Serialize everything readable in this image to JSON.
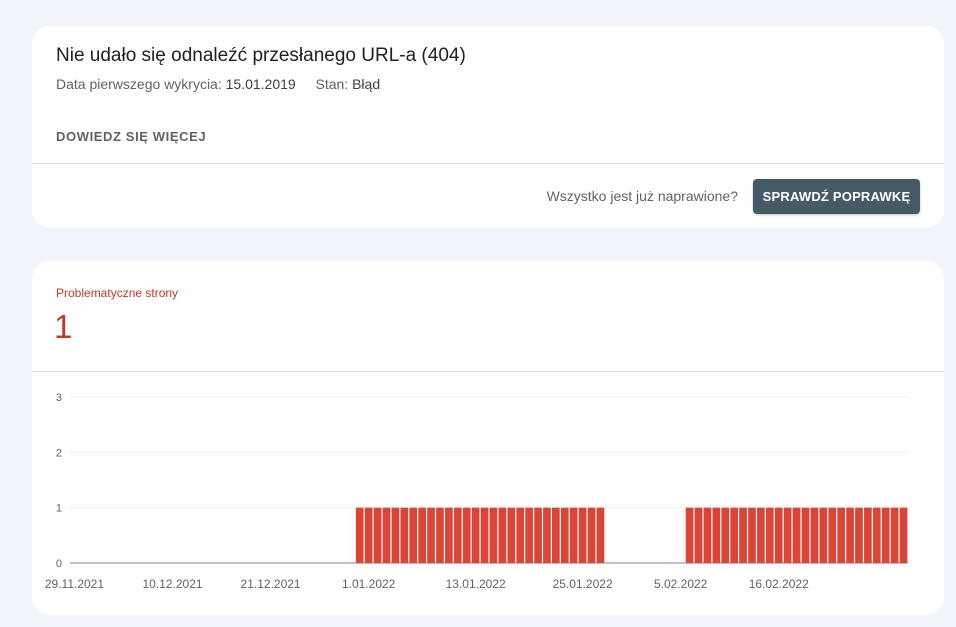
{
  "issue": {
    "title": "Nie udało się odnaleźć przesłanego URL-a (404)",
    "first_detected_label": "Data pierwszego wykrycia:",
    "first_detected_value": "15.01.2019",
    "status_label": "Stan:",
    "status_value": "Błąd",
    "learn_more": "DOWIEDZ SIĘ WIĘCEJ",
    "fixed_question": "Wszystko jest już naprawione?",
    "validate_button": "SPRAWDŹ POPRAWKĘ"
  },
  "metric": {
    "label": "Problematyczne strony",
    "value": "1"
  },
  "colors": {
    "accent": "#c0392b",
    "bar": "#db4437",
    "button": "#455a64"
  },
  "chart_data": {
    "type": "bar",
    "title": "",
    "xlabel": "",
    "ylabel": "",
    "ylim": [
      0,
      3
    ],
    "yticks": [
      "0",
      "1",
      "2",
      "3"
    ],
    "x_start": "29.11.2021",
    "x_end": "2.03.2022",
    "xtick_labels": [
      "29.11.2021",
      "10.12.2021",
      "21.12.2021",
      "1.01.2022",
      "13.01.2022",
      "25.01.2022",
      "5.02.2022",
      "16.02.2022"
    ],
    "series": [
      {
        "segments": [
          {
            "from": "29.11.2021",
            "to": "30.12.2021",
            "value": 0
          },
          {
            "from": "31.12.2021",
            "to": "27.01.2022",
            "value": 1
          },
          {
            "from": "28.01.2022",
            "to": "5.02.2022",
            "value": 0
          },
          {
            "from": "6.02.2022",
            "to": "2.03.2022",
            "value": 1
          }
        ]
      }
    ],
    "grid": true
  }
}
